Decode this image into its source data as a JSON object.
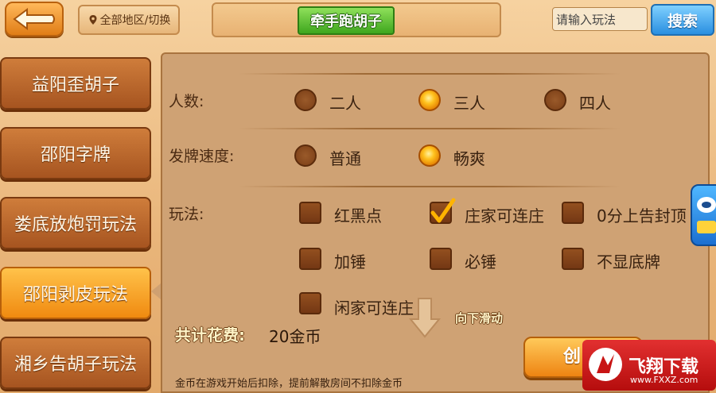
{
  "header": {
    "region_label": "全部地区/切换",
    "game_title": "牵手跑胡子",
    "search_placeholder": "请输入玩法",
    "search_label": "搜索"
  },
  "sidebar": {
    "items": [
      {
        "label": "益阳歪胡子",
        "active": false
      },
      {
        "label": "邵阳字牌",
        "active": false
      },
      {
        "label": "娄底放炮罚玩法",
        "active": false
      },
      {
        "label": "邵阳剥皮玩法",
        "active": true
      },
      {
        "label": "湘乡告胡子玩法",
        "active": false
      }
    ]
  },
  "settings": {
    "players": {
      "label": "人数:",
      "options": [
        {
          "label": "二人",
          "selected": false
        },
        {
          "label": "三人",
          "selected": true
        },
        {
          "label": "四人",
          "selected": false
        }
      ]
    },
    "deal_speed": {
      "label": "发牌速度:",
      "options": [
        {
          "label": "普通",
          "selected": false
        },
        {
          "label": "畅爽",
          "selected": true
        }
      ]
    },
    "rules": {
      "label": "玩法:",
      "options": [
        {
          "label": "红黑点",
          "checked": false
        },
        {
          "label": "庄家可连庄",
          "checked": true
        },
        {
          "label": "0分上告封顶",
          "checked": false
        },
        {
          "label": "加锤",
          "checked": false
        },
        {
          "label": "必锤",
          "checked": false
        },
        {
          "label": "不显底牌",
          "checked": false
        },
        {
          "label": "闲家可连庄",
          "checked": false
        }
      ]
    }
  },
  "footer": {
    "cost_label": "共计花费:",
    "cost_value": "20金币",
    "scroll_hint": "向下滑动",
    "note": "金币在游戏开始后扣除，提前解散房间不扣除金币",
    "create_label": "创"
  },
  "watermark": {
    "text": "飞翔下载",
    "url": "www.FXXZ.com"
  },
  "colors": {
    "accent": "#f08a10",
    "panel": "#cfa274",
    "title_green": "#3ea61e",
    "search_blue": "#2a8fe0"
  }
}
